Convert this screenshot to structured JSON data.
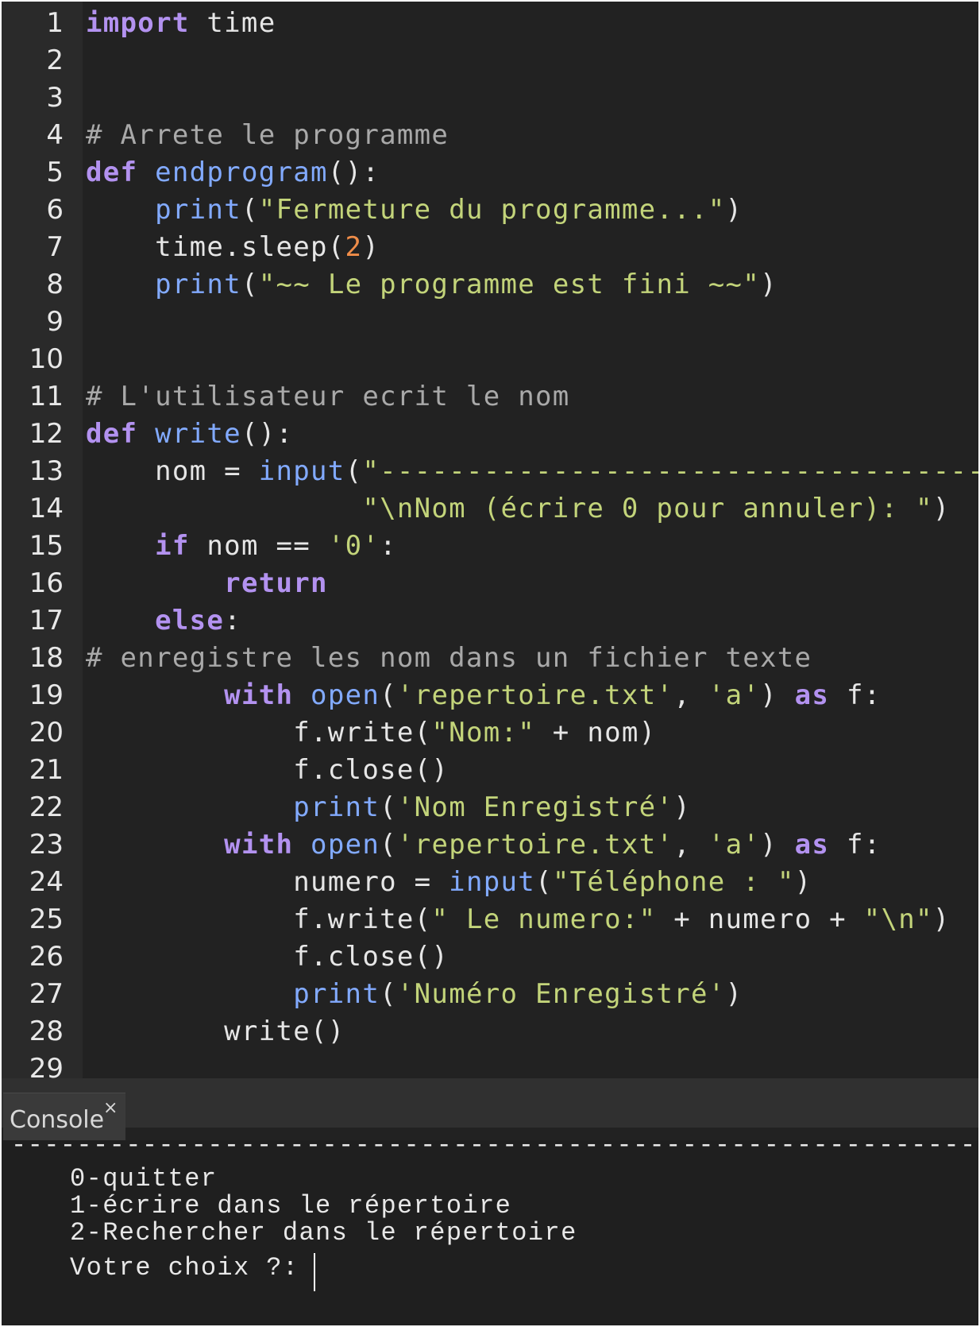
{
  "editor": {
    "lines": [
      {
        "n": "1",
        "tokens": [
          {
            "t": "import",
            "c": "kw2"
          },
          {
            "t": " time",
            "c": "plain"
          }
        ]
      },
      {
        "n": "2",
        "tokens": []
      },
      {
        "n": "3",
        "tokens": []
      },
      {
        "n": "4",
        "tokens": [
          {
            "t": "# Arrete le programme",
            "c": "com"
          }
        ]
      },
      {
        "n": "5",
        "tokens": [
          {
            "t": "def",
            "c": "kw2"
          },
          {
            "t": " ",
            "c": "plain"
          },
          {
            "t": "endprogram",
            "c": "fn"
          },
          {
            "t": "():",
            "c": "plain"
          }
        ]
      },
      {
        "n": "6",
        "tokens": [
          {
            "t": "    ",
            "c": "plain"
          },
          {
            "t": "print",
            "c": "fn"
          },
          {
            "t": "(",
            "c": "plain"
          },
          {
            "t": "\"Fermeture du programme...\"",
            "c": "str"
          },
          {
            "t": ")",
            "c": "plain"
          }
        ]
      },
      {
        "n": "7",
        "tokens": [
          {
            "t": "    time.sleep(",
            "c": "plain"
          },
          {
            "t": "2",
            "c": "num"
          },
          {
            "t": ")",
            "c": "plain"
          }
        ]
      },
      {
        "n": "8",
        "tokens": [
          {
            "t": "    ",
            "c": "plain"
          },
          {
            "t": "print",
            "c": "fn"
          },
          {
            "t": "(",
            "c": "plain"
          },
          {
            "t": "\"~~ Le programme est fini ~~\"",
            "c": "str"
          },
          {
            "t": ")",
            "c": "plain"
          }
        ]
      },
      {
        "n": "9",
        "tokens": []
      },
      {
        "n": "10",
        "tokens": []
      },
      {
        "n": "11",
        "tokens": [
          {
            "t": "# L'utilisateur ecrit le nom",
            "c": "com"
          }
        ]
      },
      {
        "n": "12",
        "tokens": [
          {
            "t": "def",
            "c": "kw2"
          },
          {
            "t": " ",
            "c": "plain"
          },
          {
            "t": "write",
            "c": "fn"
          },
          {
            "t": "():",
            "c": "plain"
          }
        ]
      },
      {
        "n": "13",
        "tokens": [
          {
            "t": "    nom = ",
            "c": "plain"
          },
          {
            "t": "input",
            "c": "fn"
          },
          {
            "t": "(",
            "c": "plain"
          },
          {
            "t": "\"-----------------------------------",
            "c": "str"
          }
        ]
      },
      {
        "n": "14",
        "tokens": [
          {
            "t": "                ",
            "c": "plain"
          },
          {
            "t": "\"\\nNom (écrire 0 pour annuler): \"",
            "c": "str"
          },
          {
            "t": ")",
            "c": "plain"
          }
        ]
      },
      {
        "n": "15",
        "tokens": [
          {
            "t": "    ",
            "c": "plain"
          },
          {
            "t": "if",
            "c": "kw2"
          },
          {
            "t": " nom == ",
            "c": "plain"
          },
          {
            "t": "'0'",
            "c": "str"
          },
          {
            "t": ":",
            "c": "plain"
          }
        ]
      },
      {
        "n": "16",
        "tokens": [
          {
            "t": "        ",
            "c": "plain"
          },
          {
            "t": "return",
            "c": "kw2"
          }
        ]
      },
      {
        "n": "17",
        "tokens": [
          {
            "t": "    ",
            "c": "plain"
          },
          {
            "t": "else",
            "c": "kw2"
          },
          {
            "t": ":",
            "c": "plain"
          }
        ]
      },
      {
        "n": "18",
        "tokens": [
          {
            "t": "# enregistre les nom dans un fichier texte",
            "c": "com"
          }
        ]
      },
      {
        "n": "19",
        "tokens": [
          {
            "t": "        ",
            "c": "plain"
          },
          {
            "t": "with",
            "c": "kw2"
          },
          {
            "t": " ",
            "c": "plain"
          },
          {
            "t": "open",
            "c": "fn"
          },
          {
            "t": "(",
            "c": "plain"
          },
          {
            "t": "'repertoire.txt'",
            "c": "str"
          },
          {
            "t": ", ",
            "c": "plain"
          },
          {
            "t": "'a'",
            "c": "str"
          },
          {
            "t": ") ",
            "c": "plain"
          },
          {
            "t": "as",
            "c": "kw2"
          },
          {
            "t": " f:",
            "c": "plain"
          }
        ]
      },
      {
        "n": "20",
        "tokens": [
          {
            "t": "            f.write(",
            "c": "plain"
          },
          {
            "t": "\"Nom:\"",
            "c": "str"
          },
          {
            "t": " + nom)",
            "c": "plain"
          }
        ]
      },
      {
        "n": "21",
        "tokens": [
          {
            "t": "            f.close()",
            "c": "plain"
          }
        ]
      },
      {
        "n": "22",
        "tokens": [
          {
            "t": "            ",
            "c": "plain"
          },
          {
            "t": "print",
            "c": "fn"
          },
          {
            "t": "(",
            "c": "plain"
          },
          {
            "t": "'Nom Enregistré'",
            "c": "str"
          },
          {
            "t": ")",
            "c": "plain"
          }
        ]
      },
      {
        "n": "23",
        "tokens": [
          {
            "t": "        ",
            "c": "plain"
          },
          {
            "t": "with",
            "c": "kw2"
          },
          {
            "t": " ",
            "c": "plain"
          },
          {
            "t": "open",
            "c": "fn"
          },
          {
            "t": "(",
            "c": "plain"
          },
          {
            "t": "'repertoire.txt'",
            "c": "str"
          },
          {
            "t": ", ",
            "c": "plain"
          },
          {
            "t": "'a'",
            "c": "str"
          },
          {
            "t": ") ",
            "c": "plain"
          },
          {
            "t": "as",
            "c": "kw2"
          },
          {
            "t": " f:",
            "c": "plain"
          }
        ]
      },
      {
        "n": "24",
        "tokens": [
          {
            "t": "            numero = ",
            "c": "plain"
          },
          {
            "t": "input",
            "c": "fn"
          },
          {
            "t": "(",
            "c": "plain"
          },
          {
            "t": "\"Téléphone : \"",
            "c": "str"
          },
          {
            "t": ")",
            "c": "plain"
          }
        ]
      },
      {
        "n": "25",
        "tokens": [
          {
            "t": "            f.write(",
            "c": "plain"
          },
          {
            "t": "\" Le numero:\"",
            "c": "str"
          },
          {
            "t": " + numero + ",
            "c": "plain"
          },
          {
            "t": "\"\\n\"",
            "c": "str"
          },
          {
            "t": ")",
            "c": "plain"
          }
        ]
      },
      {
        "n": "26",
        "tokens": [
          {
            "t": "            f.close()",
            "c": "plain"
          }
        ]
      },
      {
        "n": "27",
        "tokens": [
          {
            "t": "            ",
            "c": "plain"
          },
          {
            "t": "print",
            "c": "fn"
          },
          {
            "t": "(",
            "c": "plain"
          },
          {
            "t": "'Numéro Enregistré'",
            "c": "str"
          },
          {
            "t": ")",
            "c": "plain"
          }
        ]
      },
      {
        "n": "28",
        "tokens": [
          {
            "t": "        write()",
            "c": "plain"
          }
        ]
      },
      {
        "n": "29",
        "tokens": []
      }
    ]
  },
  "console": {
    "tab_label": "Console",
    "close_glyph": "×",
    "separator": "--------------------------------------------------------------",
    "menu": [
      "0-quitter",
      "1-écrire dans le répertoire",
      "2-Rechercher dans le répertoire"
    ],
    "prompt": "Votre choix ?:",
    "input_value": ""
  },
  "colors": {
    "background": "#222222",
    "gutter": "#2a2a2a",
    "keyword": "#b392f0",
    "function": "#82aaff",
    "string": "#c3d47a",
    "number": "#f08d49",
    "comment": "#a9a9a9"
  }
}
